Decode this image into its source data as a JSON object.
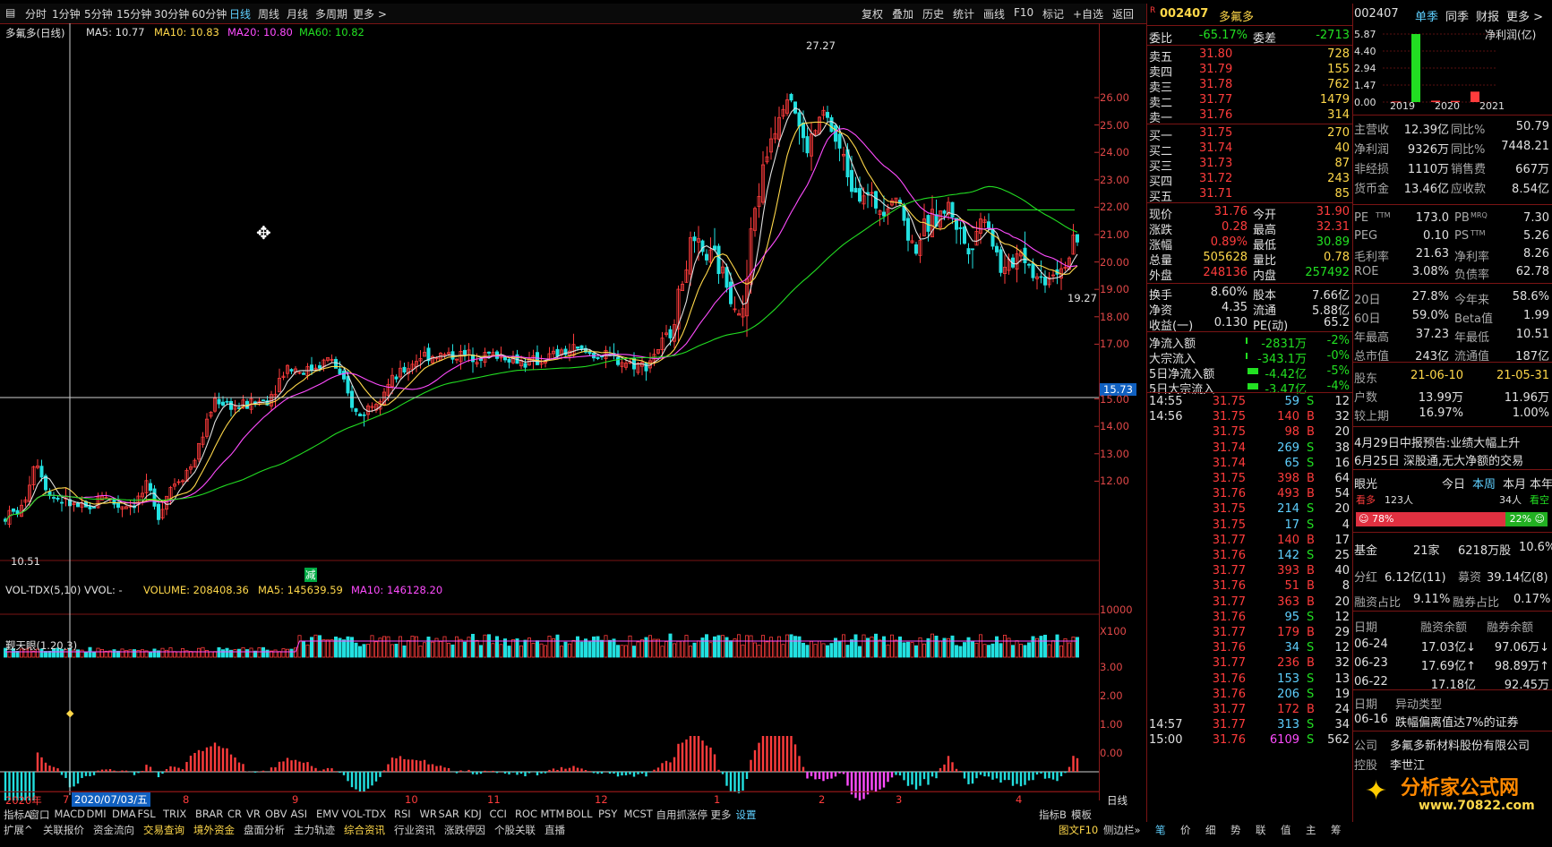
{
  "toolbar": {
    "periods": [
      "分时",
      "1分钟",
      "5分钟",
      "15分钟",
      "30分钟",
      "60分钟",
      "日线",
      "周线",
      "月线",
      "多周期",
      "更多 >"
    ],
    "right": [
      "复权",
      "叠加",
      "历史",
      "统计",
      "画线",
      "F10",
      "标记",
      "+自选",
      "返回"
    ]
  },
  "main": {
    "title": "多氟多(日线)",
    "ma5": "MA5: 10.77",
    "ma10": "MA10: 10.83",
    "ma20": "MA20: 10.80",
    "ma60": "MA60: 10.82",
    "high_label": "27.27",
    "low_label": "10.51",
    "last_label": "19.27",
    "cursor_price": "15.73",
    "marker": "减",
    "price_ticks": [
      "26.00",
      "25.00",
      "24.00",
      "23.00",
      "22.00",
      "21.00",
      "20.00",
      "19.00",
      "18.00",
      "17.00",
      "15.00",
      "14.00",
      "13.00",
      "12.00"
    ]
  },
  "volume": {
    "title": "VOL-TDX(5,10)",
    "vvol": "VVOL: -",
    "volume": "VOLUME: 208408.36",
    "ma5": "MA5: 145639.59",
    "ma10": "MA10: 146128.20",
    "tick": "10000",
    "unit": "X100"
  },
  "indicator": {
    "title": "觐天眼(1.20,3)",
    "ticks": [
      "3.00",
      "2.00",
      "1.00",
      "0.00"
    ]
  },
  "xaxis": {
    "year": "2020年",
    "date": "2020/07/03/五",
    "months": [
      "7",
      "8",
      "9",
      "10",
      "11",
      "12",
      "1",
      "2",
      "3",
      "4"
    ],
    "right": "日线"
  },
  "indicator_tabs": [
    "指标A",
    "窗口",
    "MACD",
    "DMI",
    "DMA",
    "FSL",
    "TRIX",
    "BRAR",
    "CR",
    "VR",
    "OBV",
    "ASI",
    "EMV",
    "VOL-TDX",
    "RSI",
    "WR",
    "SAR",
    "KDJ",
    "CCI",
    "ROC",
    "MTM",
    "BOLL",
    "PSY",
    "MCST",
    "自用抓涨停",
    "更多",
    "设置"
  ],
  "indicator_tabs_right": [
    "指标B",
    "模板"
  ],
  "bottom_tabs": [
    "扩展^",
    "关联报价",
    "资金流向",
    "交易查询",
    "境外资金",
    "盘面分析",
    "主力轨迹",
    "综合资讯",
    "行业资讯",
    "涨跌停因",
    "个股关联",
    "直播"
  ],
  "bottom_right": "图文F10",
  "bottom_right2": "侧边栏»",
  "bottom_mid_tabs": [
    "笔",
    "价",
    "细",
    "势",
    "联",
    "值",
    "主",
    "筹"
  ],
  "quote": {
    "code": "002407",
    "name": "多氟多",
    "flag": "R",
    "weibi_label": "委比",
    "weibi": "-65.17%",
    "weicha_label": "委差",
    "weicha": "-2713",
    "sell": [
      {
        "label": "卖五",
        "price": "31.80",
        "vol": "728"
      },
      {
        "label": "卖四",
        "price": "31.79",
        "vol": "155"
      },
      {
        "label": "卖三",
        "price": "31.78",
        "vol": "762"
      },
      {
        "label": "卖二",
        "price": "31.77",
        "vol": "1479"
      },
      {
        "label": "卖一",
        "price": "31.76",
        "vol": "314"
      }
    ],
    "buy": [
      {
        "label": "买一",
        "price": "31.75",
        "vol": "270"
      },
      {
        "label": "买二",
        "price": "31.74",
        "vol": "40"
      },
      {
        "label": "买三",
        "price": "31.73",
        "vol": "87"
      },
      {
        "label": "买四",
        "price": "31.72",
        "vol": "243"
      },
      {
        "label": "买五",
        "price": "31.71",
        "vol": "85"
      }
    ],
    "stats": [
      {
        "l1": "现价",
        "v1": "31.76",
        "l2": "今开",
        "v2": "31.90"
      },
      {
        "l1": "涨跌",
        "v1": "0.28",
        "l2": "最高",
        "v2": "32.31"
      },
      {
        "l1": "涨幅",
        "v1": "0.89%",
        "l2": "最低",
        "v2": "30.89"
      },
      {
        "l1": "总量",
        "v1": "505628",
        "l2": "量比",
        "v2": "0.78"
      },
      {
        "l1": "外盘",
        "v1": "248136",
        "l2": "内盘",
        "v2": "257492"
      }
    ],
    "stats2": [
      {
        "l1": "换手",
        "v1": "8.60%",
        "l2": "股本",
        "v2": "7.66亿"
      },
      {
        "l1": "净资",
        "v1": "4.35",
        "l2": "流通",
        "v2": "5.88亿"
      },
      {
        "l1": "收益(一)",
        "v1": "0.130",
        "l2": "PE(动)",
        "v2": "65.2"
      }
    ],
    "flows": [
      {
        "l": "净流入额",
        "v": "-2831万",
        "p": "-2%"
      },
      {
        "l": "大宗流入",
        "v": "-343.1万",
        "p": "-0%"
      },
      {
        "l": "5日净流入额",
        "v": "-4.42亿",
        "p": "-5%"
      },
      {
        "l": "5日大宗流入",
        "v": "-3.47亿",
        "p": "-4%"
      }
    ],
    "ticks": [
      {
        "t": "14:55",
        "p": "31.75",
        "v": "59",
        "s": "S",
        "n": "12"
      },
      {
        "t": "14:56",
        "p": "31.75",
        "v": "140",
        "s": "B",
        "n": "32"
      },
      {
        "t": "",
        "p": "31.75",
        "v": "98",
        "s": "B",
        "n": "20"
      },
      {
        "t": "",
        "p": "31.74",
        "v": "269",
        "s": "S",
        "n": "38"
      },
      {
        "t": "",
        "p": "31.74",
        "v": "65",
        "s": "S",
        "n": "16"
      },
      {
        "t": "",
        "p": "31.75",
        "v": "398",
        "s": "B",
        "n": "64"
      },
      {
        "t": "",
        "p": "31.76",
        "v": "493",
        "s": "B",
        "n": "54"
      },
      {
        "t": "",
        "p": "31.75",
        "v": "214",
        "s": "S",
        "n": "20"
      },
      {
        "t": "",
        "p": "31.75",
        "v": "17",
        "s": "S",
        "n": "4"
      },
      {
        "t": "",
        "p": "31.77",
        "v": "140",
        "s": "B",
        "n": "17"
      },
      {
        "t": "",
        "p": "31.76",
        "v": "142",
        "s": "S",
        "n": "25"
      },
      {
        "t": "",
        "p": "31.77",
        "v": "393",
        "s": "B",
        "n": "40"
      },
      {
        "t": "",
        "p": "31.76",
        "v": "51",
        "s": "B",
        "n": "8"
      },
      {
        "t": "",
        "p": "31.77",
        "v": "363",
        "s": "B",
        "n": "20"
      },
      {
        "t": "",
        "p": "31.76",
        "v": "95",
        "s": "S",
        "n": "12"
      },
      {
        "t": "",
        "p": "31.77",
        "v": "179",
        "s": "B",
        "n": "29"
      },
      {
        "t": "",
        "p": "31.76",
        "v": "34",
        "s": "S",
        "n": "12"
      },
      {
        "t": "",
        "p": "31.77",
        "v": "236",
        "s": "B",
        "n": "32"
      },
      {
        "t": "",
        "p": "31.76",
        "v": "153",
        "s": "S",
        "n": "13"
      },
      {
        "t": "",
        "p": "31.76",
        "v": "206",
        "s": "S",
        "n": "19"
      },
      {
        "t": "",
        "p": "31.77",
        "v": "172",
        "s": "B",
        "n": "24"
      },
      {
        "t": "14:57",
        "p": "31.77",
        "v": "313",
        "s": "S",
        "n": "34"
      },
      {
        "t": "15:00",
        "p": "31.76",
        "v": "6109",
        "s": "S",
        "n": "562"
      }
    ]
  },
  "info": {
    "code": "002407",
    "tabs": [
      "单季",
      "同季",
      "财报",
      "更多 >"
    ],
    "bar_ticks": [
      "5.87",
      "4.40",
      "2.94",
      "1.47",
      "0.00"
    ],
    "bar_years": [
      "2019",
      "2020",
      "2021"
    ],
    "bar_label": "净利润(亿)",
    "bar_values": [
      0.05,
      5.87,
      0.12,
      0.1,
      0.9
    ],
    "fin": [
      {
        "l1": "主营收",
        "v1": "12.39亿",
        "l2": "同比%",
        "v2": "50.79"
      },
      {
        "l1": "净利润",
        "v1": "9326万",
        "l2": "同比%",
        "v2": "7448.21"
      },
      {
        "l1": "非经损",
        "v1": "1110万",
        "l2": "销售费",
        "v2": "667万"
      },
      {
        "l1": "货币金",
        "v1": "13.46亿",
        "l2": "应收款",
        "v2": "8.54亿"
      }
    ],
    "val": [
      {
        "l1": "PE",
        "s1": "TTM",
        "v1": "173.0",
        "l2": "PB",
        "s2": "MRQ",
        "v2": "7.30"
      },
      {
        "l1": "PEG",
        "s1": "",
        "v1": "0.10",
        "l2": "PS",
        "s2": "TTM",
        "v2": "5.26"
      },
      {
        "l1": "毛利率",
        "s1": "",
        "v1": "21.63",
        "l2": "净利率",
        "s2": "",
        "v2": "8.26"
      },
      {
        "l1": "ROE",
        "s1": "",
        "v1": "3.08%",
        "l2": "负债率",
        "s2": "",
        "v2": "62.78"
      }
    ],
    "perf": [
      {
        "l1": "20日",
        "v1": "27.8%",
        "l2": "今年来",
        "v2": "58.6%"
      },
      {
        "l1": "60日",
        "v1": "59.0%",
        "l2": "Beta值",
        "v2": "1.99"
      },
      {
        "l1": "年最高",
        "v1": "37.23",
        "l2": "年最低",
        "v2": "10.51"
      },
      {
        "l1": "总市值",
        "v1": "243亿",
        "l2": "流通值",
        "v2": "187亿"
      }
    ],
    "holders": [
      {
        "l": "股东",
        "a": "21-06-10",
        "b": "21-05-31"
      },
      {
        "l": "户数",
        "a": "13.99万",
        "b": "11.96万"
      },
      {
        "l": "较上期",
        "a": "16.97%",
        "b": "1.00%"
      }
    ],
    "news": [
      "4月29日中报预告:业绩大幅上升",
      "6月25日 深股通,无大净额的交易"
    ],
    "eye": {
      "label": "眼光",
      "periods": [
        "今日",
        "本周",
        "本月",
        "本年"
      ],
      "bull": "看多",
      "bull_n": "123人",
      "bear_n": "34人",
      "bear": "看空",
      "bull_pct": "78%",
      "bear_pct": "22%",
      "bull_frac": 0.78
    },
    "fund": {
      "l": "基金",
      "n": "21家",
      "v": "6218万股",
      "p": "10.6%"
    },
    "div": {
      "l": "分红",
      "v": "6.12亿(11)",
      "l2": "募资",
      "v2": "39.14亿(8)"
    },
    "margin": {
      "l": "融资占比",
      "v": "9.11%",
      "l2": "融券占比",
      "v2": "0.17%"
    },
    "margin_head": [
      "日期",
      "融资余额",
      "融券余额"
    ],
    "margin_rows": [
      [
        "06-24",
        "17.03亿↓",
        "97.06万↓"
      ],
      [
        "06-23",
        "17.69亿↑",
        "98.89万↑"
      ],
      [
        "06-22",
        "17.18亿",
        "92.45万"
      ]
    ],
    "abn_head": [
      "日期",
      "异动类型"
    ],
    "abn_row": [
      "06-16",
      "跌幅偏离值达7%的证券"
    ],
    "company": {
      "l": "公司",
      "v": "多氟多新材料股份有限公司"
    },
    "ctrl": {
      "l": "控股",
      "v": "李世江"
    },
    "logo": "分析家公式网",
    "logo_url": "www.70822.com"
  },
  "colors": {
    "up": "#ff3c3c",
    "down": "#22e0e0",
    "ma5": "#e0e0e0",
    "ma10": "#ffd84a",
    "ma20": "#ff4cff",
    "ma60": "#22dd22",
    "grid": "#7a1414"
  }
}
